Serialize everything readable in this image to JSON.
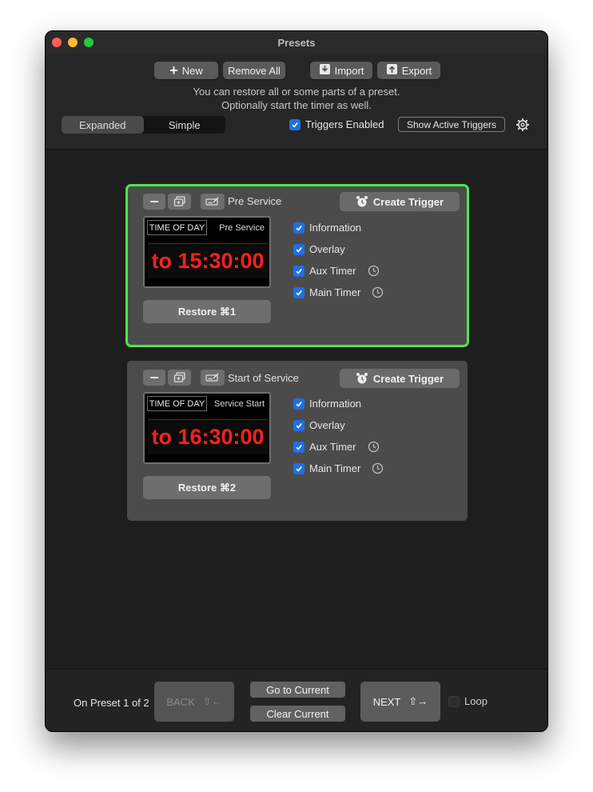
{
  "window": {
    "title": "Presets"
  },
  "toolbar": {
    "new_label": "New",
    "remove_all_label": "Remove All",
    "import_label": "Import",
    "export_label": "Export"
  },
  "hint": {
    "line1": "You can restore all or some parts of a preset.",
    "line2": "Optionally start the timer as well."
  },
  "view_mode": {
    "options": [
      "Expanded",
      "Simple"
    ],
    "selected": "Expanded"
  },
  "triggers": {
    "enabled_label": "Triggers Enabled",
    "enabled": true,
    "show_active_label": "Show Active Triggers"
  },
  "presets": [
    {
      "name": "Pre Service",
      "selected": true,
      "create_trigger_label": "Create Trigger",
      "display": {
        "mode": "TIME OF DAY",
        "name": "Pre Service",
        "time": "to 15:30:00"
      },
      "restore_label": "Restore ⌘1",
      "options": [
        {
          "label": "Information",
          "checked": true,
          "has_clock": false
        },
        {
          "label": "Overlay",
          "checked": true,
          "has_clock": false
        },
        {
          "label": "Aux Timer",
          "checked": true,
          "has_clock": true
        },
        {
          "label": "Main Timer",
          "checked": true,
          "has_clock": true
        }
      ]
    },
    {
      "name": "Start of Service",
      "selected": false,
      "create_trigger_label": "Create Trigger",
      "display": {
        "mode": "TIME OF DAY",
        "name": "Service Start",
        "time": "to 16:30:00"
      },
      "restore_label": "Restore ⌘2",
      "options": [
        {
          "label": "Information",
          "checked": true,
          "has_clock": false
        },
        {
          "label": "Overlay",
          "checked": true,
          "has_clock": false
        },
        {
          "label": "Aux Timer",
          "checked": true,
          "has_clock": true
        },
        {
          "label": "Main Timer",
          "checked": true,
          "has_clock": true
        }
      ]
    }
  ],
  "footer": {
    "status": "On Preset 1 of 2",
    "back_label": "BACK",
    "back_shortcut": "⇧←",
    "go_to_current_label": "Go to Current",
    "clear_current_label": "Clear Current",
    "next_label": "NEXT",
    "next_shortcut": "⇧→",
    "loop_label": "Loop",
    "loop_checked": false
  },
  "colors": {
    "accent_blue": "#1f6fe5",
    "selected_outline": "#4ee64b",
    "timer_red": "#ff1f1f"
  }
}
